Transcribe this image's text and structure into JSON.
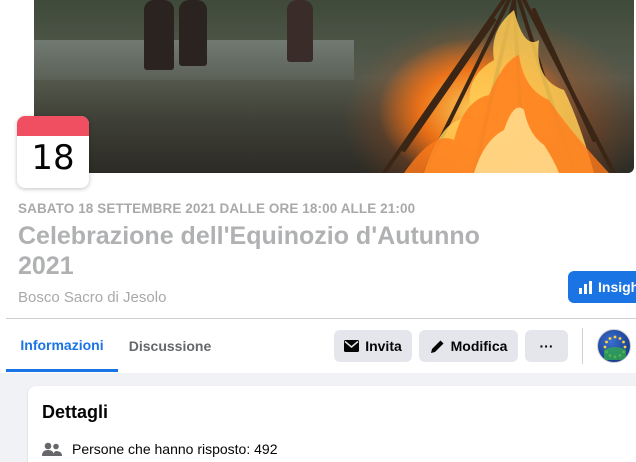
{
  "event": {
    "date_badge_day": "18",
    "when": "SABATO 18 SETTEMBRE 2021 DALLE ORE 18:00 ALLE 21:00",
    "title": "Celebrazione dell'Equinozio d'Autunno 2021",
    "place": "Bosco Sacro di Jesolo"
  },
  "header_actions": {
    "insights_label": "Insigh"
  },
  "tabs": [
    {
      "label": "Informazioni",
      "active": true
    },
    {
      "label": "Discussione",
      "active": false
    }
  ],
  "actions": {
    "invite_label": "Invita",
    "edit_label": "Modifica",
    "more_label": "···"
  },
  "details": {
    "title": "Dettagli",
    "responders": "Persone che hanno risposto: 492"
  },
  "icons": {
    "insights": "bar-chart-icon",
    "invite": "envelope-icon",
    "edit": "pencil-icon",
    "responders": "people-icon"
  },
  "colors": {
    "accent": "#1b74e4",
    "date_band": "#ef4f61",
    "button_bg": "#e4e6eb"
  }
}
